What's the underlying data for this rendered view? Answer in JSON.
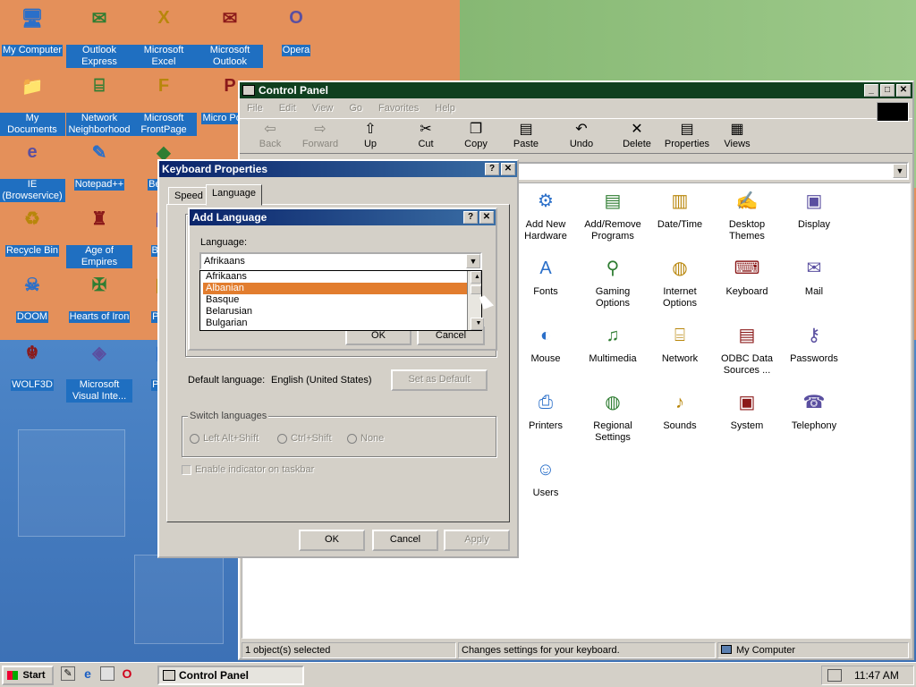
{
  "desktop": {
    "icons": [
      {
        "label": "My Computer",
        "icon": "computer-icon"
      },
      {
        "label": "Outlook Express",
        "icon": "outlook-express-icon"
      },
      {
        "label": "Microsoft Excel",
        "icon": "excel-icon"
      },
      {
        "label": "Microsoft Outlook",
        "icon": "outlook-icon"
      },
      {
        "label": "Opera",
        "icon": "opera-icon"
      },
      {
        "label": "My Documents",
        "icon": "folder-icon"
      },
      {
        "label": "Network Neighborhood",
        "icon": "network-icon"
      },
      {
        "label": "Microsoft FrontPage",
        "icon": "frontpage-icon"
      },
      {
        "label": "Micro Power",
        "icon": "powerpoint-icon"
      },
      {
        "label": "IE (Browservice)",
        "icon": "ie-icon"
      },
      {
        "label": "Notepad++",
        "icon": "notepad-icon"
      },
      {
        "label": "Bete D",
        "icon": "bete-icon"
      },
      {
        "label": "Recycle Bin",
        "icon": "recycle-bin-icon"
      },
      {
        "label": "Age of Empires",
        "icon": "age-of-empires-icon"
      },
      {
        "label": "Big D",
        "icon": "big-icon"
      },
      {
        "label": "DOOM",
        "icon": "doom-icon"
      },
      {
        "label": "Hearts of Iron",
        "icon": "hearts-of-iron-icon"
      },
      {
        "label": "Pagg",
        "icon": "pagg-icon"
      },
      {
        "label": "WOLF3D",
        "icon": "wolf3d-icon"
      },
      {
        "label": "Microsoft Visual Inte...",
        "icon": "visual-interdev-icon"
      },
      {
        "label": "Pla Z",
        "icon": "pla-icon"
      }
    ]
  },
  "control_panel": {
    "title": "Control Panel",
    "menu": [
      "File",
      "Edit",
      "View",
      "Go",
      "Favorites",
      "Help"
    ],
    "toolbar": [
      {
        "label": "Back",
        "icon": "back-arrow-icon",
        "enabled": false
      },
      {
        "label": "Forward",
        "icon": "forward-arrow-icon",
        "enabled": false
      },
      {
        "label": "Up",
        "icon": "up-folder-icon",
        "enabled": true
      },
      {
        "label": "Cut",
        "icon": "cut-icon",
        "enabled": true
      },
      {
        "label": "Copy",
        "icon": "copy-icon",
        "enabled": true
      },
      {
        "label": "Paste",
        "icon": "paste-icon",
        "enabled": true
      },
      {
        "label": "Undo",
        "icon": "undo-icon",
        "enabled": true
      },
      {
        "label": "Delete",
        "icon": "delete-icon",
        "enabled": true
      },
      {
        "label": "Properties",
        "icon": "properties-icon",
        "enabled": true
      },
      {
        "label": "Views",
        "icon": "views-icon",
        "enabled": true
      }
    ],
    "items": [
      {
        "label": "Add New Hardware",
        "icon": "hardware-icon"
      },
      {
        "label": "Add/Remove Programs",
        "icon": "add-remove-icon"
      },
      {
        "label": "Date/Time",
        "icon": "calendar-clock-icon"
      },
      {
        "label": "Desktop Themes",
        "icon": "themes-icon"
      },
      {
        "label": "Display",
        "icon": "display-icon"
      },
      {
        "label": "Fonts",
        "icon": "fonts-folder-icon"
      },
      {
        "label": "Gaming Options",
        "icon": "joystick-icon"
      },
      {
        "label": "Internet Options",
        "icon": "globe-icon"
      },
      {
        "label": "Keyboard",
        "icon": "keyboard-icon"
      },
      {
        "label": "Mail",
        "icon": "mail-icon"
      },
      {
        "label": "Mouse",
        "icon": "mouse-icon"
      },
      {
        "label": "Multimedia",
        "icon": "multimedia-icon"
      },
      {
        "label": "Network",
        "icon": "network-icon"
      },
      {
        "label": "ODBC Data Sources ...",
        "icon": "odbc-icon"
      },
      {
        "label": "Passwords",
        "icon": "keys-icon"
      },
      {
        "label": "Printers",
        "icon": "printers-folder-icon"
      },
      {
        "label": "Regional Settings",
        "icon": "globe-icon"
      },
      {
        "label": "Sounds",
        "icon": "speaker-icon"
      },
      {
        "label": "System",
        "icon": "system-computer-icon"
      },
      {
        "label": "Telephony",
        "icon": "telephone-icon"
      },
      {
        "label": "Users",
        "icon": "users-icon"
      }
    ],
    "status": {
      "selected": "1 object(s) selected",
      "description": "Changes settings for your keyboard.",
      "location": "My Computer"
    }
  },
  "keyboard_properties": {
    "title": "Keyboard Properties",
    "tabs": [
      "Speed",
      "Language"
    ],
    "default_language_label": "Default language:",
    "default_language_value": "English (United States)",
    "set_default_button": "Set as Default",
    "switch_languages_label": "Switch languages",
    "switch_options": [
      "Left Alt+Shift",
      "Ctrl+Shift",
      "None"
    ],
    "enable_indicator_label": "Enable indicator on taskbar",
    "ok": "OK",
    "cancel": "Cancel",
    "apply": "Apply"
  },
  "add_language": {
    "title": "Add Language",
    "language_label": "Language:",
    "selected_value": "Afrikaans",
    "list": [
      "Afrikaans",
      "Albanian",
      "Basque",
      "Belarusian",
      "Bulgarian"
    ],
    "highlighted_index": 1,
    "ok": "OK",
    "cancel": "Cancel"
  },
  "taskbar": {
    "start_label": "Start",
    "task_label": "Control Panel",
    "clock": "11:47 AM"
  },
  "colors": {
    "control_panel_titlebar": "#10401f",
    "dialog_titlebar": "#0a246a",
    "list_highlight": "#e27d2e"
  }
}
